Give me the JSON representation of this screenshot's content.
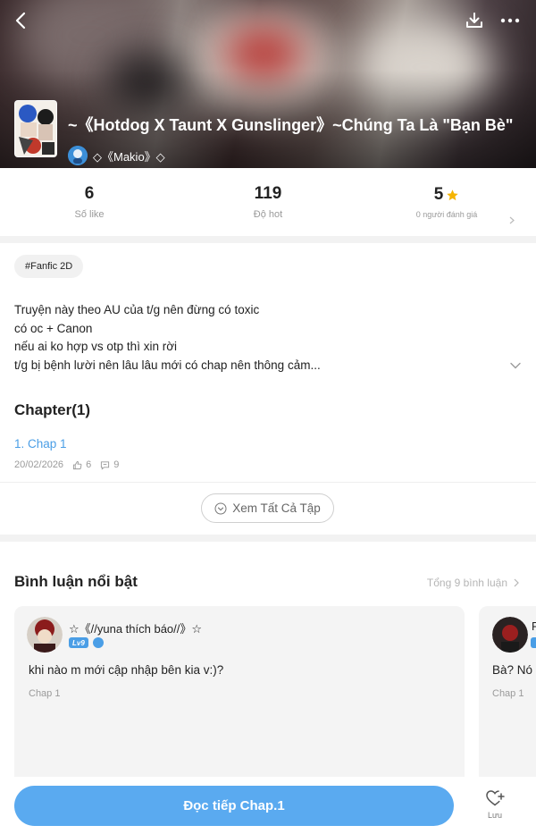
{
  "header": {
    "title": "~《Hotdog X Taunt X Gunslinger》~Chúng Ta Là \"Bạn Bè\"",
    "author": "◇《Makio》◇",
    "icons": [
      "back-icon",
      "download-icon",
      "more-icon"
    ]
  },
  "stats": {
    "likes_value": "6",
    "likes_label": "Số like",
    "hot_value": "119",
    "hot_label": "Độ hot",
    "rating_value": "5",
    "rating_label": "0 người đánh giá"
  },
  "tag": "#Fanfic 2D",
  "description": [
    "Truyện này theo AU của t/g nên đừng có toxic",
    "có oc + Canon",
    "nếu ai ko hợp vs otp thì xin rời",
    "t/g bị bệnh lười nên lâu lâu mới có chap nên thông cảm..."
  ],
  "chapters": {
    "heading": "Chapter(1)",
    "items": [
      {
        "title": "1. Chap 1",
        "date": "20/02/2026",
        "likes": "6",
        "comments": "9"
      }
    ],
    "see_all": "Xem Tất Cả Tập"
  },
  "comments": {
    "heading": "Bình luận nổi bật",
    "total": "Tổng 9 bình luận",
    "items": [
      {
        "name": "☆《//yuna thích báo//》☆",
        "level": "Lv9",
        "text": "khi nào m mới cập nhập bên kia v:)?",
        "chapter": "Chap 1"
      },
      {
        "name": "F",
        "text": "Bà? Nó",
        "chapter": "Chap 1"
      }
    ]
  },
  "bottom": {
    "read_label": "Đọc tiếp Chap.1",
    "save_label": "Lưu"
  },
  "colors": {
    "accent": "#5aaaf0",
    "link": "#4a9ee6",
    "star": "#f5b400"
  }
}
